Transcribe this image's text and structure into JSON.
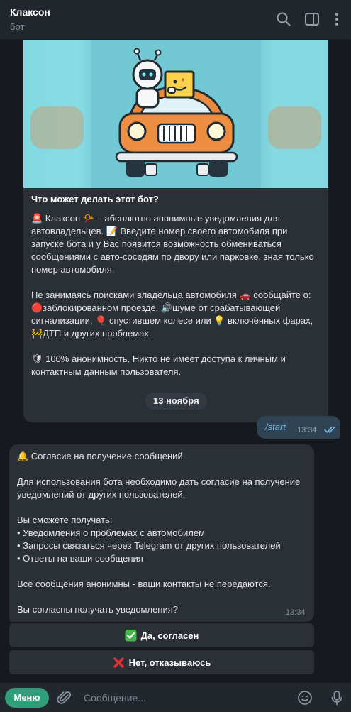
{
  "header": {
    "title": "Клаксон",
    "subtitle": "бот",
    "icons": [
      "search-icon",
      "sidebar-toggle-icon",
      "more-icon"
    ]
  },
  "intro": {
    "heading": "Что может делать этот бот?",
    "body": "🚨 Клаксон 📯 – абсолютно анонимные уведомления для автовладельцев. 📝 Введите номер своего автомобиля при запуске бота и у Вас появится возможность обмениваться сообщениями с авто-соседям по двору или парковке, зная только номер автомобиля.\n\nНе занимаясь поисками владельца автомобиля 🚗 сообщайте о: 🔴заблокированном проезде, 🔊шуме от срабатывающей сигнализации, 🎈 спустившем колесе или 💡 включённых фарах, 🚧ДТП и других проблемах.\n\n🛡 100% анонимность. Никто не имеет доступа к личным и контактным данным пользователя."
  },
  "date_separator": "13 ноября",
  "outgoing": {
    "text": "/start",
    "time": "13:34",
    "status": "read"
  },
  "incoming": {
    "body": "🔔 Согласие на получение сообщений\n\nДля использования бота необходимо дать согласие на получение уведомлений от других пользователей.\n\nВы сможете получать:\n• Уведомления о проблемах с автомобилем\n• Запросы связаться через Telegram от других пользователей\n• Ответы на ваши сообщения\n\nВсе сообщения анонимны - ваши контакты не передаются.\n\nВы согласны получать уведомления?",
    "time": "13:34"
  },
  "buttons": {
    "agree": "Да, согласен",
    "decline": "Нет, отказываюсь"
  },
  "composer": {
    "menu_label": "Меню",
    "placeholder": "Сообщение..."
  },
  "colors": {
    "background": "#16191e",
    "bubble": "#2b2f36",
    "outgoing_bubble": "#2f4354",
    "accent": "#2f9e7a",
    "link": "#6fb8e8"
  }
}
